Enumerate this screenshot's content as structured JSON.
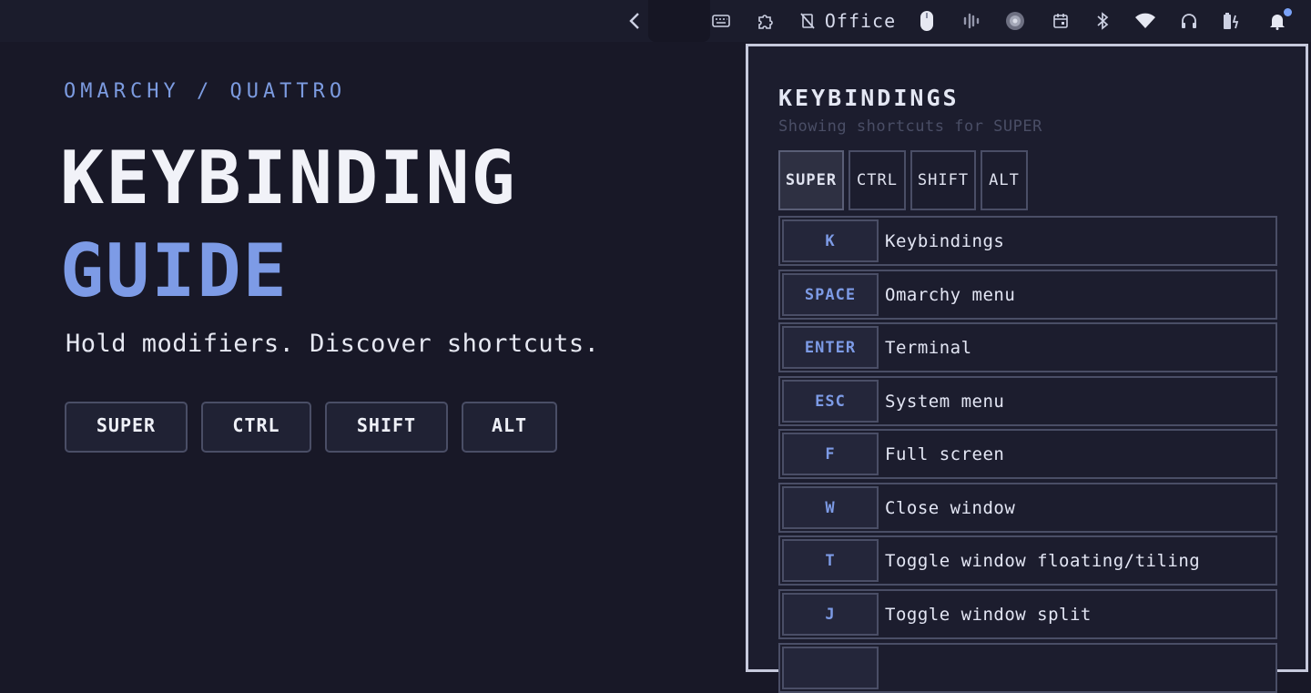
{
  "topbar": {
    "back_icon": "chevron-left-icon",
    "workspace_label": "Office",
    "icons": [
      "keyboard-icon",
      "puzzle-icon",
      "mute-icon",
      "mouse-icon",
      "audio-levels-icon",
      "globe-icon",
      "calendar-icon",
      "bluetooth-icon",
      "wifi-icon",
      "headphones-icon",
      "battery-icon",
      "bell-icon"
    ],
    "accent": "#7aa2f7"
  },
  "hero": {
    "breadcrumb": "OMARCHY / QUATTRO",
    "title_line1": "KEYBINDING",
    "title_line2": "GUIDE",
    "tagline": "Hold modifiers. Discover shortcuts.",
    "modifiers": [
      "SUPER",
      "CTRL",
      "SHIFT",
      "ALT"
    ]
  },
  "panel": {
    "title": "KEYBINDINGS",
    "subtitle": "Showing shortcuts for SUPER",
    "tabs": [
      "SUPER",
      "CTRL",
      "SHIFT",
      "ALT"
    ],
    "active_tab": "SUPER",
    "bindings": [
      {
        "key": "K",
        "action": "Keybindings"
      },
      {
        "key": "SPACE",
        "action": "Omarchy menu"
      },
      {
        "key": "ENTER",
        "action": "Terminal"
      },
      {
        "key": "ESC",
        "action": "System menu"
      },
      {
        "key": "F",
        "action": "Full screen"
      },
      {
        "key": "W",
        "action": "Close window"
      },
      {
        "key": "T",
        "action": "Toggle window floating/tiling"
      },
      {
        "key": "J",
        "action": "Toggle window split"
      }
    ]
  },
  "colors": {
    "background": "#181827",
    "accent_blue": "#7d9be6",
    "border": "#4a4e66"
  }
}
